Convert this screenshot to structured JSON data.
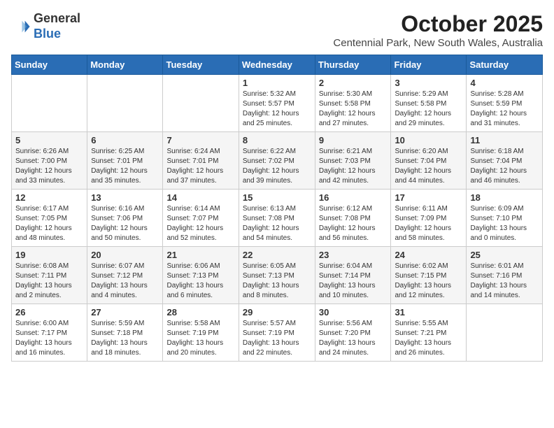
{
  "header": {
    "logo_general": "General",
    "logo_blue": "Blue",
    "month_year": "October 2025",
    "subtitle": "Centennial Park, New South Wales, Australia"
  },
  "weekdays": [
    "Sunday",
    "Monday",
    "Tuesday",
    "Wednesday",
    "Thursday",
    "Friday",
    "Saturday"
  ],
  "weeks": [
    [
      {
        "day": "",
        "content": ""
      },
      {
        "day": "",
        "content": ""
      },
      {
        "day": "",
        "content": ""
      },
      {
        "day": "1",
        "content": "Sunrise: 5:32 AM\nSunset: 5:57 PM\nDaylight: 12 hours\nand 25 minutes."
      },
      {
        "day": "2",
        "content": "Sunrise: 5:30 AM\nSunset: 5:58 PM\nDaylight: 12 hours\nand 27 minutes."
      },
      {
        "day": "3",
        "content": "Sunrise: 5:29 AM\nSunset: 5:58 PM\nDaylight: 12 hours\nand 29 minutes."
      },
      {
        "day": "4",
        "content": "Sunrise: 5:28 AM\nSunset: 5:59 PM\nDaylight: 12 hours\nand 31 minutes."
      }
    ],
    [
      {
        "day": "5",
        "content": "Sunrise: 6:26 AM\nSunset: 7:00 PM\nDaylight: 12 hours\nand 33 minutes."
      },
      {
        "day": "6",
        "content": "Sunrise: 6:25 AM\nSunset: 7:01 PM\nDaylight: 12 hours\nand 35 minutes."
      },
      {
        "day": "7",
        "content": "Sunrise: 6:24 AM\nSunset: 7:01 PM\nDaylight: 12 hours\nand 37 minutes."
      },
      {
        "day": "8",
        "content": "Sunrise: 6:22 AM\nSunset: 7:02 PM\nDaylight: 12 hours\nand 39 minutes."
      },
      {
        "day": "9",
        "content": "Sunrise: 6:21 AM\nSunset: 7:03 PM\nDaylight: 12 hours\nand 42 minutes."
      },
      {
        "day": "10",
        "content": "Sunrise: 6:20 AM\nSunset: 7:04 PM\nDaylight: 12 hours\nand 44 minutes."
      },
      {
        "day": "11",
        "content": "Sunrise: 6:18 AM\nSunset: 7:04 PM\nDaylight: 12 hours\nand 46 minutes."
      }
    ],
    [
      {
        "day": "12",
        "content": "Sunrise: 6:17 AM\nSunset: 7:05 PM\nDaylight: 12 hours\nand 48 minutes."
      },
      {
        "day": "13",
        "content": "Sunrise: 6:16 AM\nSunset: 7:06 PM\nDaylight: 12 hours\nand 50 minutes."
      },
      {
        "day": "14",
        "content": "Sunrise: 6:14 AM\nSunset: 7:07 PM\nDaylight: 12 hours\nand 52 minutes."
      },
      {
        "day": "15",
        "content": "Sunrise: 6:13 AM\nSunset: 7:08 PM\nDaylight: 12 hours\nand 54 minutes."
      },
      {
        "day": "16",
        "content": "Sunrise: 6:12 AM\nSunset: 7:08 PM\nDaylight: 12 hours\nand 56 minutes."
      },
      {
        "day": "17",
        "content": "Sunrise: 6:11 AM\nSunset: 7:09 PM\nDaylight: 12 hours\nand 58 minutes."
      },
      {
        "day": "18",
        "content": "Sunrise: 6:09 AM\nSunset: 7:10 PM\nDaylight: 13 hours\nand 0 minutes."
      }
    ],
    [
      {
        "day": "19",
        "content": "Sunrise: 6:08 AM\nSunset: 7:11 PM\nDaylight: 13 hours\nand 2 minutes."
      },
      {
        "day": "20",
        "content": "Sunrise: 6:07 AM\nSunset: 7:12 PM\nDaylight: 13 hours\nand 4 minutes."
      },
      {
        "day": "21",
        "content": "Sunrise: 6:06 AM\nSunset: 7:13 PM\nDaylight: 13 hours\nand 6 minutes."
      },
      {
        "day": "22",
        "content": "Sunrise: 6:05 AM\nSunset: 7:13 PM\nDaylight: 13 hours\nand 8 minutes."
      },
      {
        "day": "23",
        "content": "Sunrise: 6:04 AM\nSunset: 7:14 PM\nDaylight: 13 hours\nand 10 minutes."
      },
      {
        "day": "24",
        "content": "Sunrise: 6:02 AM\nSunset: 7:15 PM\nDaylight: 13 hours\nand 12 minutes."
      },
      {
        "day": "25",
        "content": "Sunrise: 6:01 AM\nSunset: 7:16 PM\nDaylight: 13 hours\nand 14 minutes."
      }
    ],
    [
      {
        "day": "26",
        "content": "Sunrise: 6:00 AM\nSunset: 7:17 PM\nDaylight: 13 hours\nand 16 minutes."
      },
      {
        "day": "27",
        "content": "Sunrise: 5:59 AM\nSunset: 7:18 PM\nDaylight: 13 hours\nand 18 minutes."
      },
      {
        "day": "28",
        "content": "Sunrise: 5:58 AM\nSunset: 7:19 PM\nDaylight: 13 hours\nand 20 minutes."
      },
      {
        "day": "29",
        "content": "Sunrise: 5:57 AM\nSunset: 7:19 PM\nDaylight: 13 hours\nand 22 minutes."
      },
      {
        "day": "30",
        "content": "Sunrise: 5:56 AM\nSunset: 7:20 PM\nDaylight: 13 hours\nand 24 minutes."
      },
      {
        "day": "31",
        "content": "Sunrise: 5:55 AM\nSunset: 7:21 PM\nDaylight: 13 hours\nand 26 minutes."
      },
      {
        "day": "",
        "content": ""
      }
    ]
  ]
}
